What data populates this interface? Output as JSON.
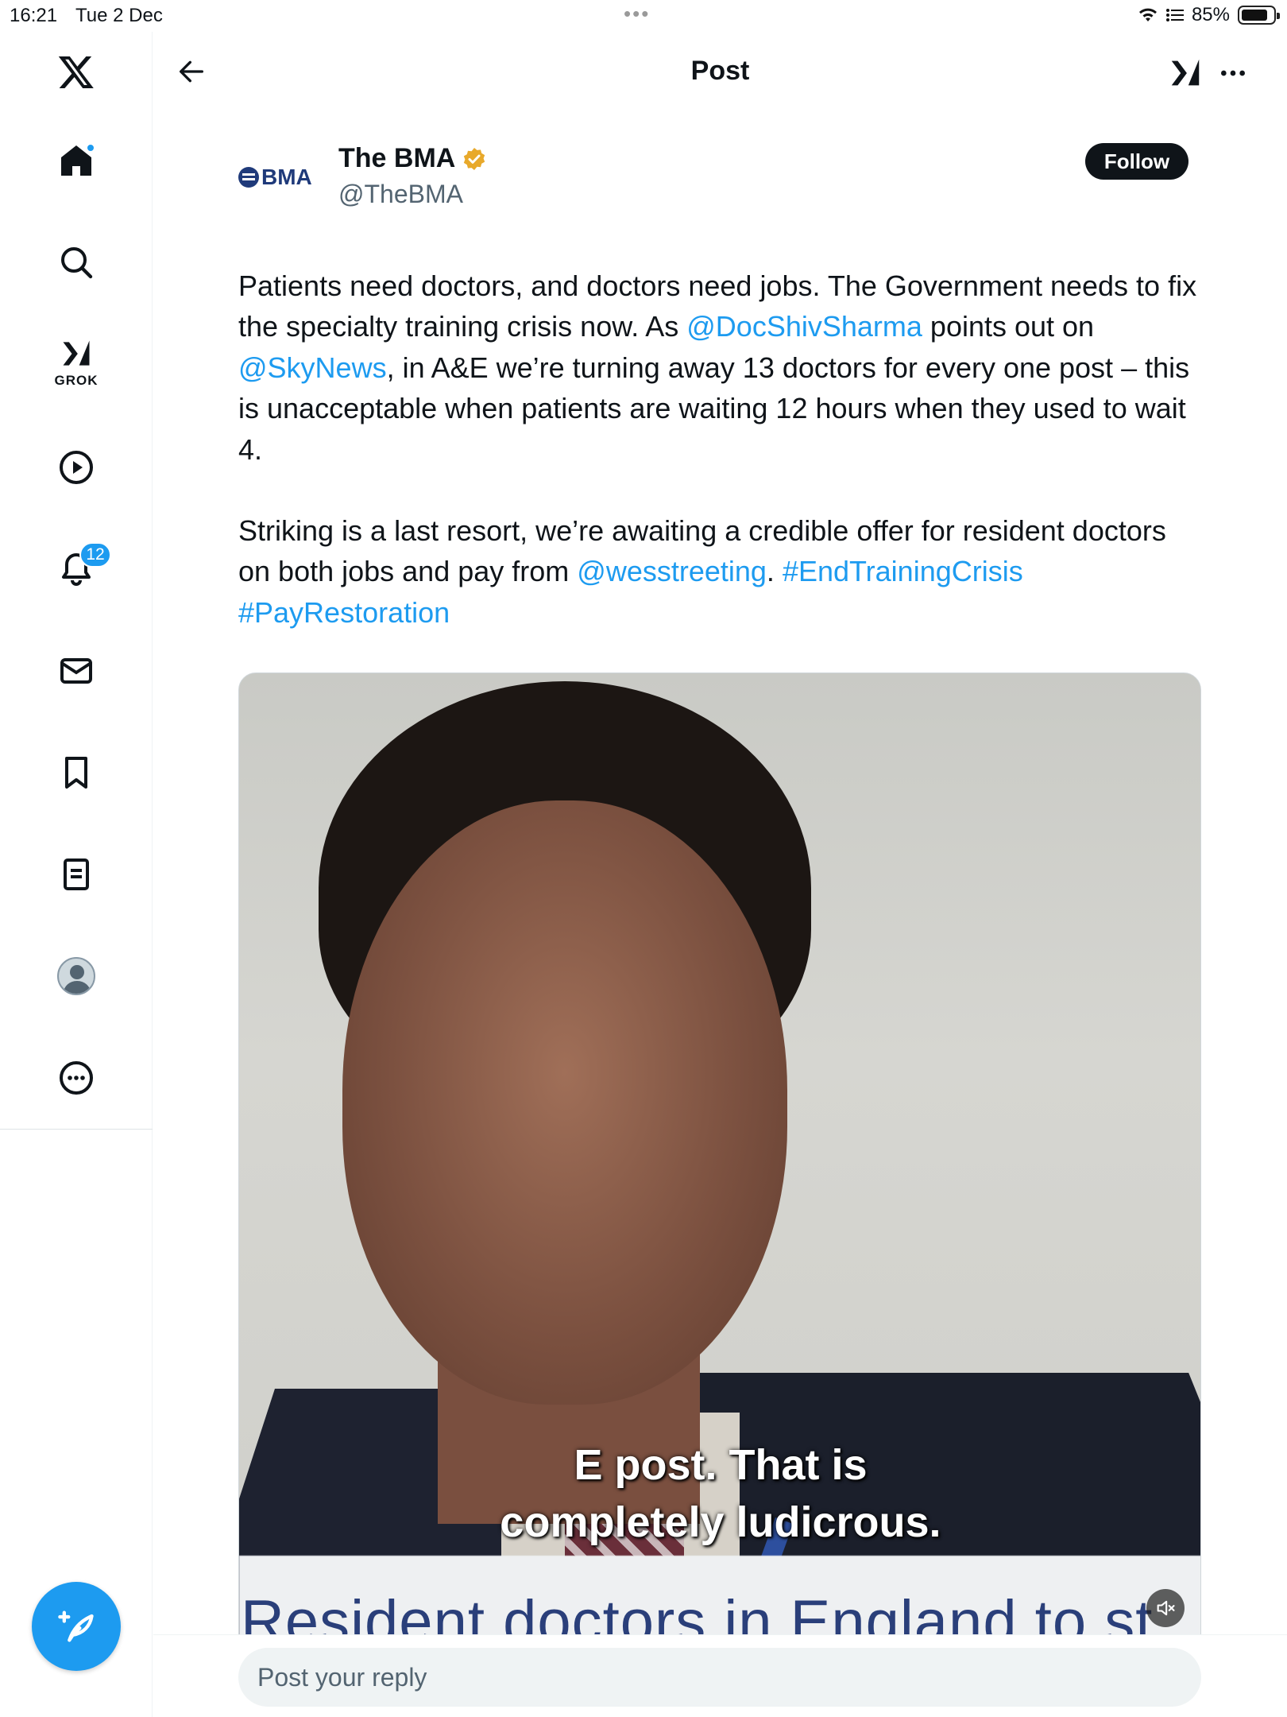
{
  "status_bar": {
    "time": "16:21",
    "date": "Tue 2 Dec",
    "battery_text": "85%",
    "battery_level": 0.85
  },
  "sidebar": {
    "items": [
      {
        "name": "home",
        "icon": "home-icon"
      },
      {
        "name": "explore",
        "icon": "search-icon"
      },
      {
        "name": "grok",
        "icon": "grok-icon",
        "label": "GROK"
      },
      {
        "name": "video",
        "icon": "play-icon"
      },
      {
        "name": "notifications",
        "icon": "bell-icon",
        "badge": "12"
      },
      {
        "name": "messages",
        "icon": "mail-icon"
      },
      {
        "name": "bookmarks",
        "icon": "bookmark-icon"
      },
      {
        "name": "lists",
        "icon": "list-icon"
      },
      {
        "name": "profile",
        "icon": "avatar"
      },
      {
        "name": "more",
        "icon": "more-circle-icon"
      }
    ],
    "compose_icon": "compose-icon"
  },
  "header": {
    "title": "Post"
  },
  "post": {
    "author_name": "The BMA",
    "author_handle": "@TheBMA",
    "logo_text": "BMA",
    "follow_label": "Follow",
    "paragraph1": {
      "t1": "Patients need doctors, and doctors need jobs. The Government needs to fix the specialty training crisis now. As ",
      "m1": "@DocShivSharma",
      "t2": " points out on ",
      "m2": "@SkyNews",
      "t3": ", in A&E we’re turning away 13 doctors for every one post – this is unacceptable when patients are waiting 12 hours when they used to wait 4."
    },
    "paragraph2": {
      "t1": "Striking is a last resort, we’re awaiting a credible offer for resident doctors on both jobs and pay from ",
      "m1": "@wesstreeting",
      "t2": ". ",
      "h1": "#EndTrainingCrisis",
      "t3": " ",
      "h2": "#PayRestoration"
    },
    "video": {
      "caption_line1": "E post. That is",
      "caption_line2": "completely ludicrous.",
      "lower_third": "Resident doctors in England to st"
    }
  },
  "reply": {
    "placeholder": "Post your reply"
  },
  "colors": {
    "accent": "#1d9bf0",
    "text": "#0f1419",
    "muted": "#536471",
    "verified": "#e8a92b"
  }
}
